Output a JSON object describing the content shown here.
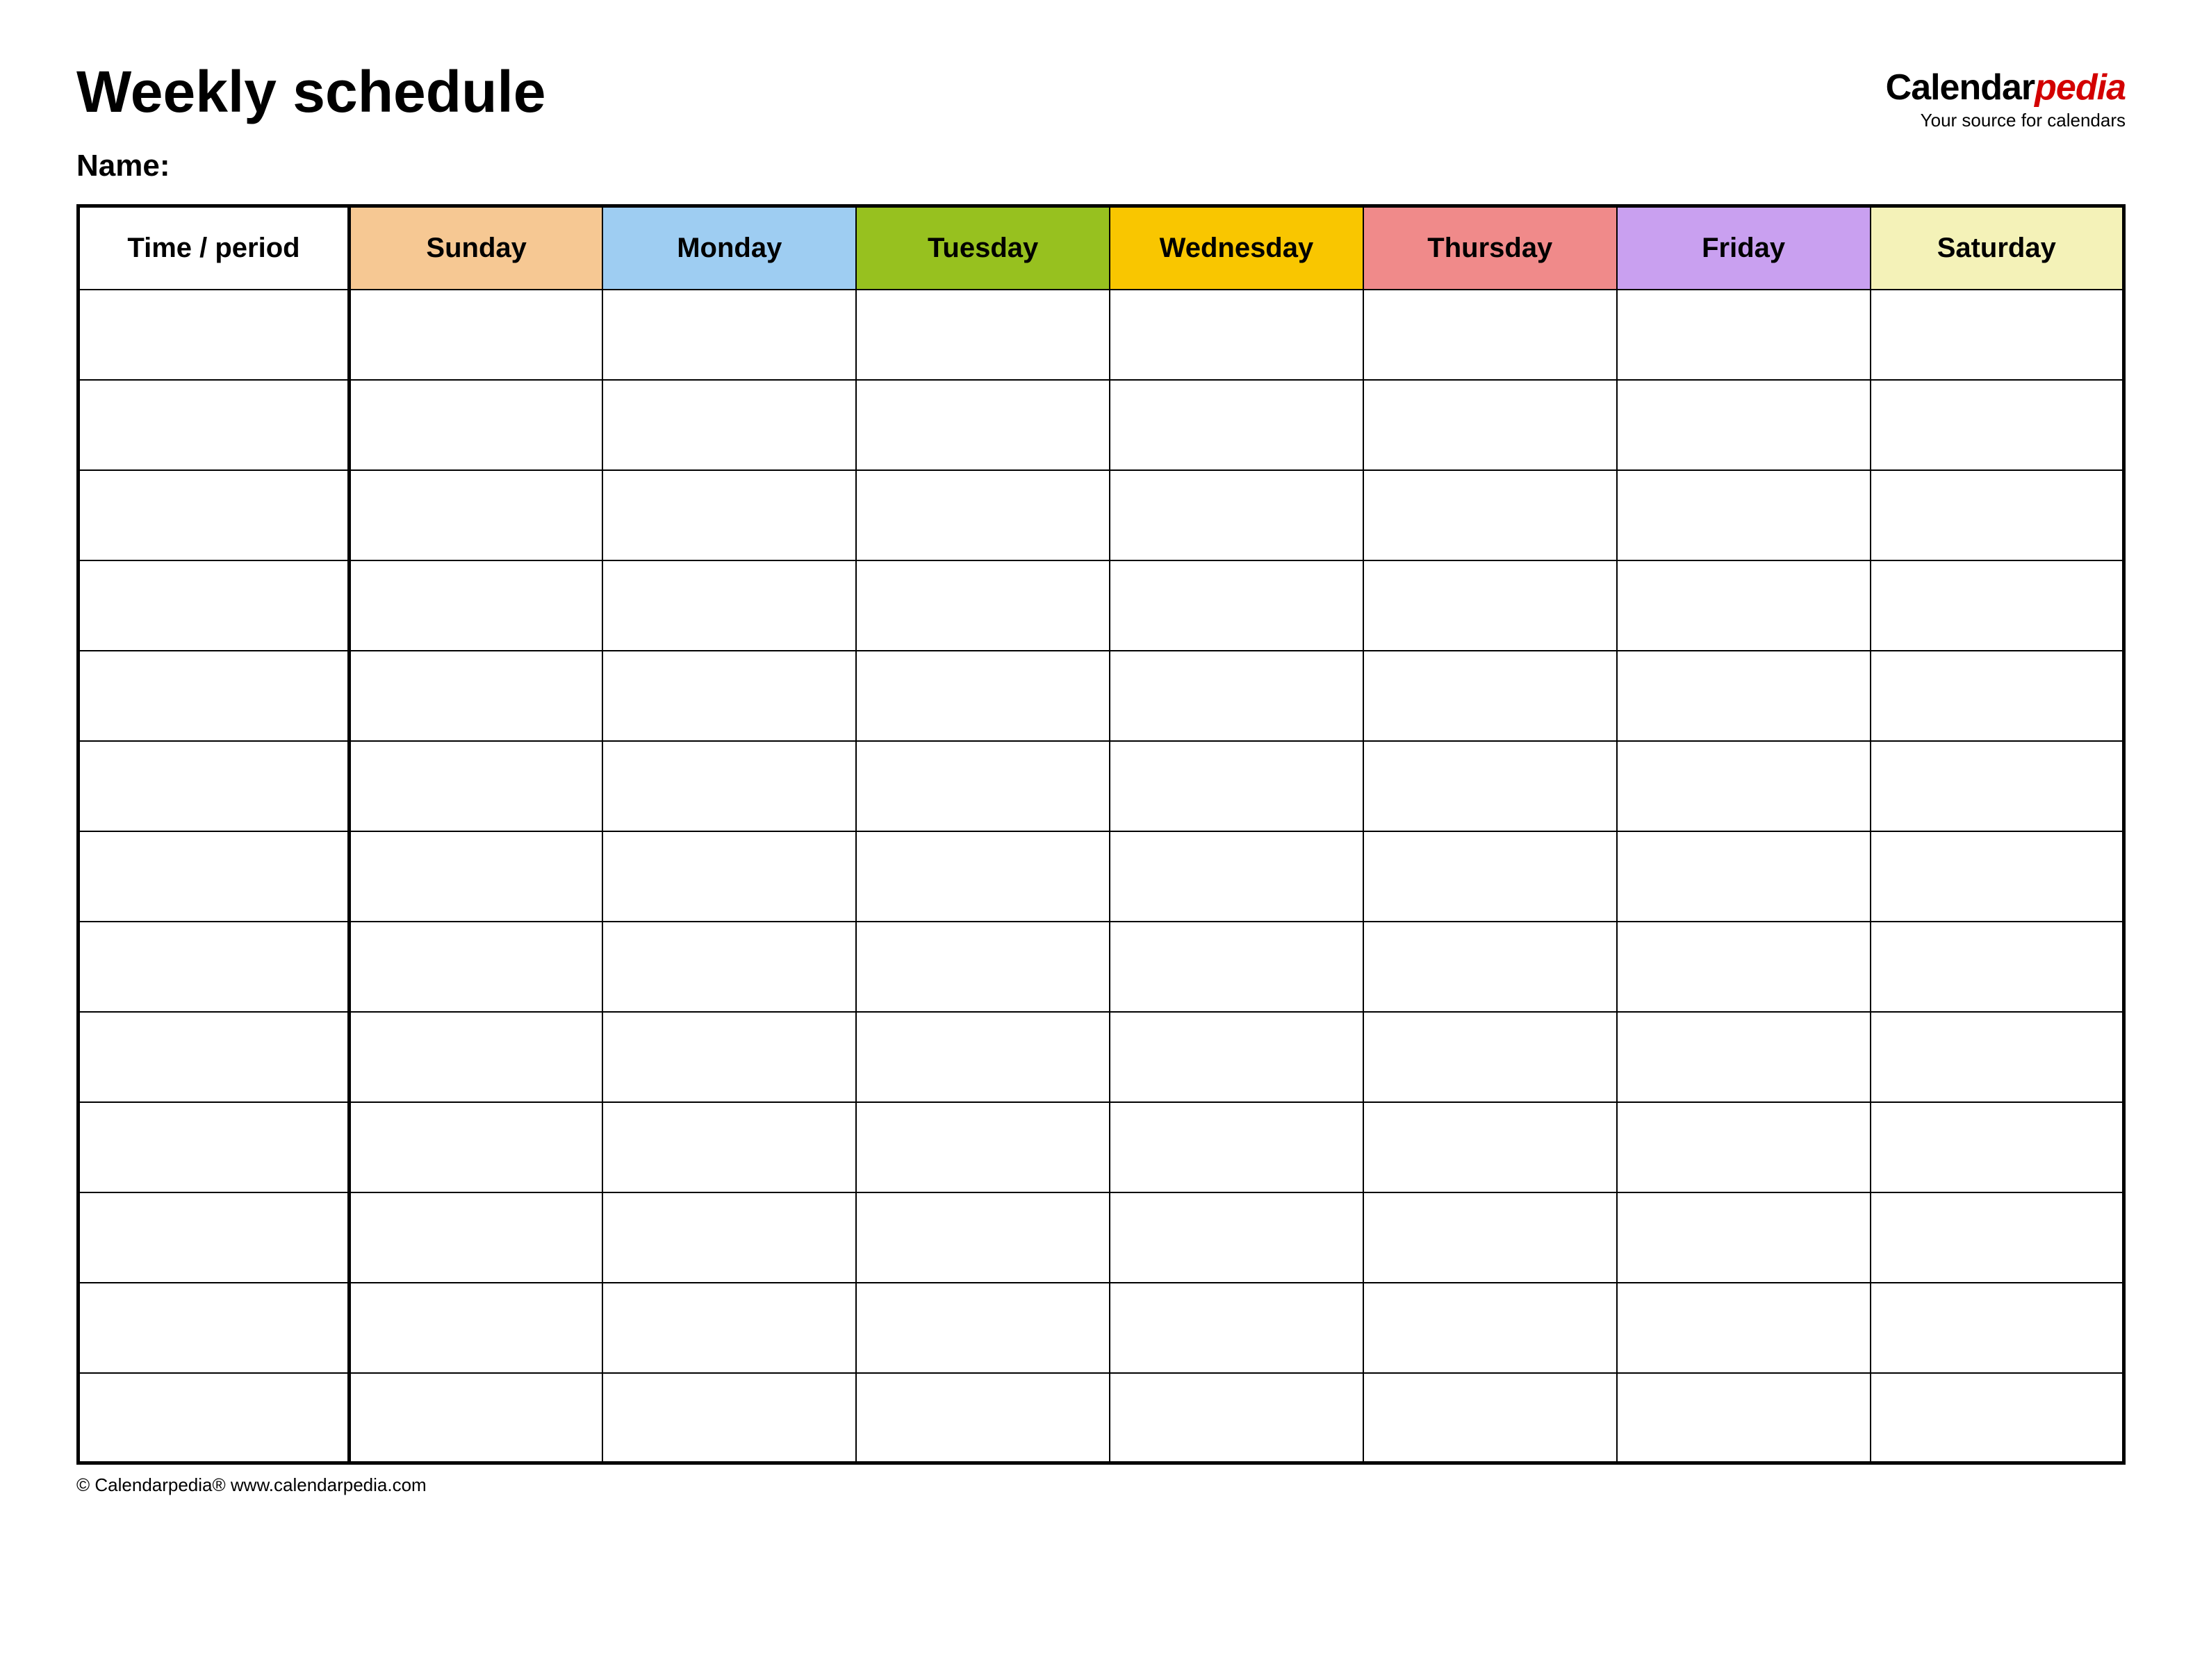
{
  "header": {
    "title": "Weekly schedule",
    "name_label": "Name:"
  },
  "logo": {
    "brand_part1": "Calendar",
    "brand_part2": "pedia",
    "tagline": "Your source for calendars"
  },
  "table": {
    "time_period_label": "Time / period",
    "days": [
      {
        "label": "Sunday",
        "color": "#f6c893"
      },
      {
        "label": "Monday",
        "color": "#9ecdf2"
      },
      {
        "label": "Tuesday",
        "color": "#97c11f"
      },
      {
        "label": "Wednesday",
        "color": "#f9c600"
      },
      {
        "label": "Thursday",
        "color": "#f08a8a"
      },
      {
        "label": "Friday",
        "color": "#c9a0f0"
      },
      {
        "label": "Saturday",
        "color": "#f4f2b8"
      }
    ],
    "row_count": 13
  },
  "footer": {
    "copyright": "© Calendarpedia®   www.calendarpedia.com"
  }
}
